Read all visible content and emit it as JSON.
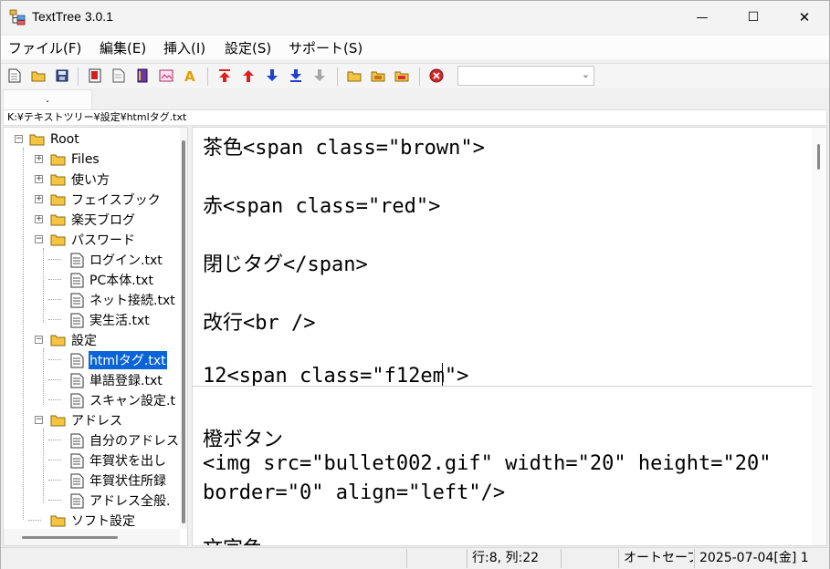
{
  "window": {
    "title": "TextTree 3.0.1",
    "min_glyph": "—",
    "max_glyph": "☐",
    "close_glyph": "✕"
  },
  "menu": [
    "ファイル(F)",
    "編集(E)",
    "挿入(I)",
    "設定(S)",
    "サポート(S)"
  ],
  "toolbar": {
    "icons": [
      "new-file-icon",
      "open-folder-icon",
      "save-icon",
      "bookmark-red-icon",
      "page-icon",
      "book-icon",
      "image-icon",
      "font-icon",
      "move-top-icon",
      "move-up-icon",
      "move-down-icon",
      "move-bottom-icon",
      "move-disabled-icon",
      "folder-a-icon",
      "folder-b-icon",
      "folder-c-icon",
      "delete-icon"
    ],
    "combo_value": ""
  },
  "tabs": [
    {
      "label": "."
    }
  ],
  "path": "K:¥テキストツリー¥設定¥htmlタグ.txt",
  "tree": {
    "root": "Root",
    "nodes": [
      {
        "label": "Files"
      },
      {
        "label": "使い方"
      },
      {
        "label": "フェイスブック"
      },
      {
        "label": "楽天ブログ"
      },
      {
        "label": "パスワード"
      },
      {
        "label": "ログイン.txt"
      },
      {
        "label": "PC本体.txt"
      },
      {
        "label": "ネット接続.txt"
      },
      {
        "label": "実生活.txt"
      },
      {
        "label": "設定"
      },
      {
        "label": "htmlタグ.txt"
      },
      {
        "label": "単語登録.txt"
      },
      {
        "label": "スキャン設定.t"
      },
      {
        "label": "アドレス"
      },
      {
        "label": "自分のアドレス"
      },
      {
        "label": "年賀状を出し"
      },
      {
        "label": "年賀状住所録"
      },
      {
        "label": "アドレス全般."
      },
      {
        "label": "ソフト設定"
      }
    ]
  },
  "editor": {
    "lines": [
      "茶色<span class=\"brown\">",
      "赤<span class=\"red\">",
      "閉じタグ</span>",
      "改行<br />",
      "12<span class=\"f12em\">",
      "橙ボタン",
      "<img src=\"bullet002.gif\" width=\"20\" height=\"20\"",
      "border=\"0\" align=\"left\"/>",
      "文字色"
    ]
  },
  "status": {
    "cell1": "",
    "position": "行:8, 列:22",
    "cell3": "",
    "autosave": "オートセーブ",
    "datetime": "2025-07-04[金] 1"
  }
}
